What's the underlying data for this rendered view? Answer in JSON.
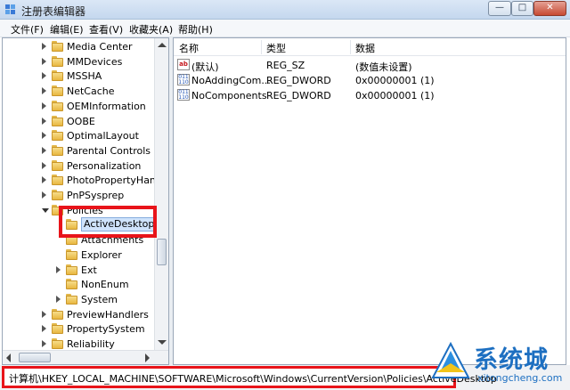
{
  "window": {
    "title": "注册表编辑器",
    "min_glyph": "—",
    "max_glyph": "□",
    "close_glyph": "✕"
  },
  "menu": [
    {
      "label": "文件(F)"
    },
    {
      "label": "编辑(E)"
    },
    {
      "label": "查看(V)"
    },
    {
      "label": "收藏夹(A)"
    },
    {
      "label": "帮助(H)"
    }
  ],
  "tree": {
    "items": [
      {
        "label": "Media Center",
        "level": 1,
        "state": "collapsed"
      },
      {
        "label": "MMDevices",
        "level": 1,
        "state": "collapsed"
      },
      {
        "label": "MSSHA",
        "level": 1,
        "state": "collapsed"
      },
      {
        "label": "NetCache",
        "level": 1,
        "state": "collapsed"
      },
      {
        "label": "OEMInformation",
        "level": 1,
        "state": "collapsed"
      },
      {
        "label": "OOBE",
        "level": 1,
        "state": "collapsed"
      },
      {
        "label": "OptimalLayout",
        "level": 1,
        "state": "collapsed"
      },
      {
        "label": "Parental Controls",
        "level": 1,
        "state": "collapsed"
      },
      {
        "label": "Personalization",
        "level": 1,
        "state": "collapsed"
      },
      {
        "label": "PhotoPropertyHandl",
        "level": 1,
        "state": "collapsed"
      },
      {
        "label": "PnPSysprep",
        "level": 1,
        "state": "collapsed"
      },
      {
        "label": "Policies",
        "level": 1,
        "state": "expanded"
      },
      {
        "label": "ActiveDesktop",
        "level": 2,
        "state": "selected"
      },
      {
        "label": "Attachments",
        "level": 2,
        "state": "leaf"
      },
      {
        "label": "Explorer",
        "level": 2,
        "state": "leaf"
      },
      {
        "label": "Ext",
        "level": 2,
        "state": "collapsed"
      },
      {
        "label": "NonEnum",
        "level": 2,
        "state": "leaf"
      },
      {
        "label": "System",
        "level": 2,
        "state": "collapsed"
      },
      {
        "label": "PreviewHandlers",
        "level": 1,
        "state": "collapsed"
      },
      {
        "label": "PropertySystem",
        "level": 1,
        "state": "collapsed"
      },
      {
        "label": "Reliability",
        "level": 1,
        "state": "collapsed"
      }
    ]
  },
  "list": {
    "columns": [
      "名称",
      "类型",
      "数据"
    ],
    "rows": [
      {
        "icon": "string-value-icon",
        "icon_text": "ab",
        "name": "(默认)",
        "type": "REG_SZ",
        "data": "(数值未设置)"
      },
      {
        "icon": "dword-value-icon",
        "icon_text": "011\n110",
        "name": "NoAddingCom...",
        "type": "REG_DWORD",
        "data": "0x00000001 (1)"
      },
      {
        "icon": "dword-value-icon",
        "icon_text": "011\n110",
        "name": "NoComponents",
        "type": "REG_DWORD",
        "data": "0x00000001 (1)"
      }
    ]
  },
  "status": {
    "path": "计算机\\HKEY_LOCAL_MACHINE\\SOFTWARE\\Microsoft\\Windows\\CurrentVersion\\Policies\\ActiveDesktop"
  },
  "watermark": {
    "brand": "系统城",
    "domain": "xitongcheng.com"
  },
  "colors": {
    "highlight_red": "#e8141a",
    "selection": "#cfe3fc",
    "folder": "#e8b740"
  }
}
